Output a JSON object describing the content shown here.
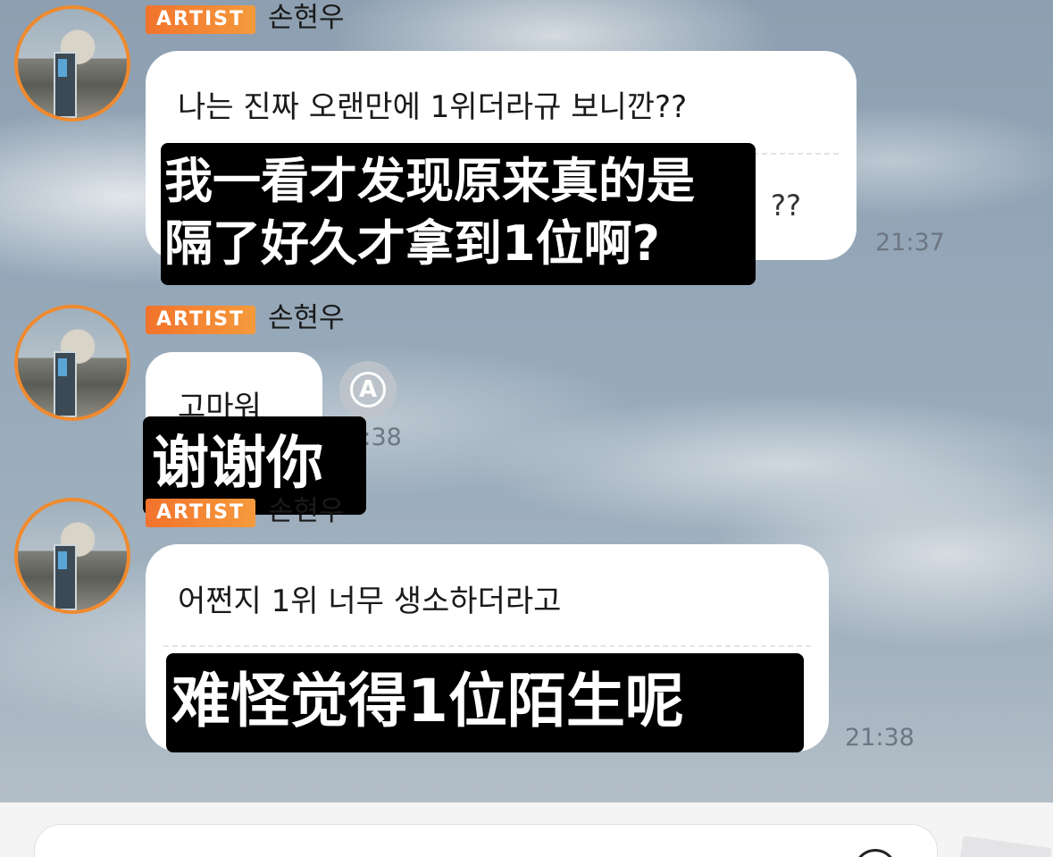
{
  "messages": [
    {
      "badge": "ARTIST",
      "sender": "손현우",
      "text": "나는 진짜 오랜만에 1위더라규 보니깐??",
      "translation_tail": "??",
      "time": "21:37",
      "subtitle_lines": [
        "我一看才发现原来真的是",
        "隔了好久才拿到1位啊?"
      ]
    },
    {
      "badge": "ARTIST",
      "sender": "손현우",
      "text": "고마워",
      "time": "21:38",
      "subtitle_lines": [
        "谢谢你"
      ]
    },
    {
      "badge": "ARTIST",
      "sender": "손현우",
      "text": "어쩐지 1위 너무 생소하더라고",
      "time": "21:38",
      "subtitle_lines": [
        "难怪觉得1位陌生呢"
      ]
    }
  ],
  "translate_button": {
    "icon": "translate-icon",
    "glyph": "A"
  },
  "composer": {
    "placeholder": ""
  },
  "colors": {
    "badge": "#f2732c",
    "avatar_ring": "#f08a2e",
    "subtitle_bg": "#000000"
  }
}
